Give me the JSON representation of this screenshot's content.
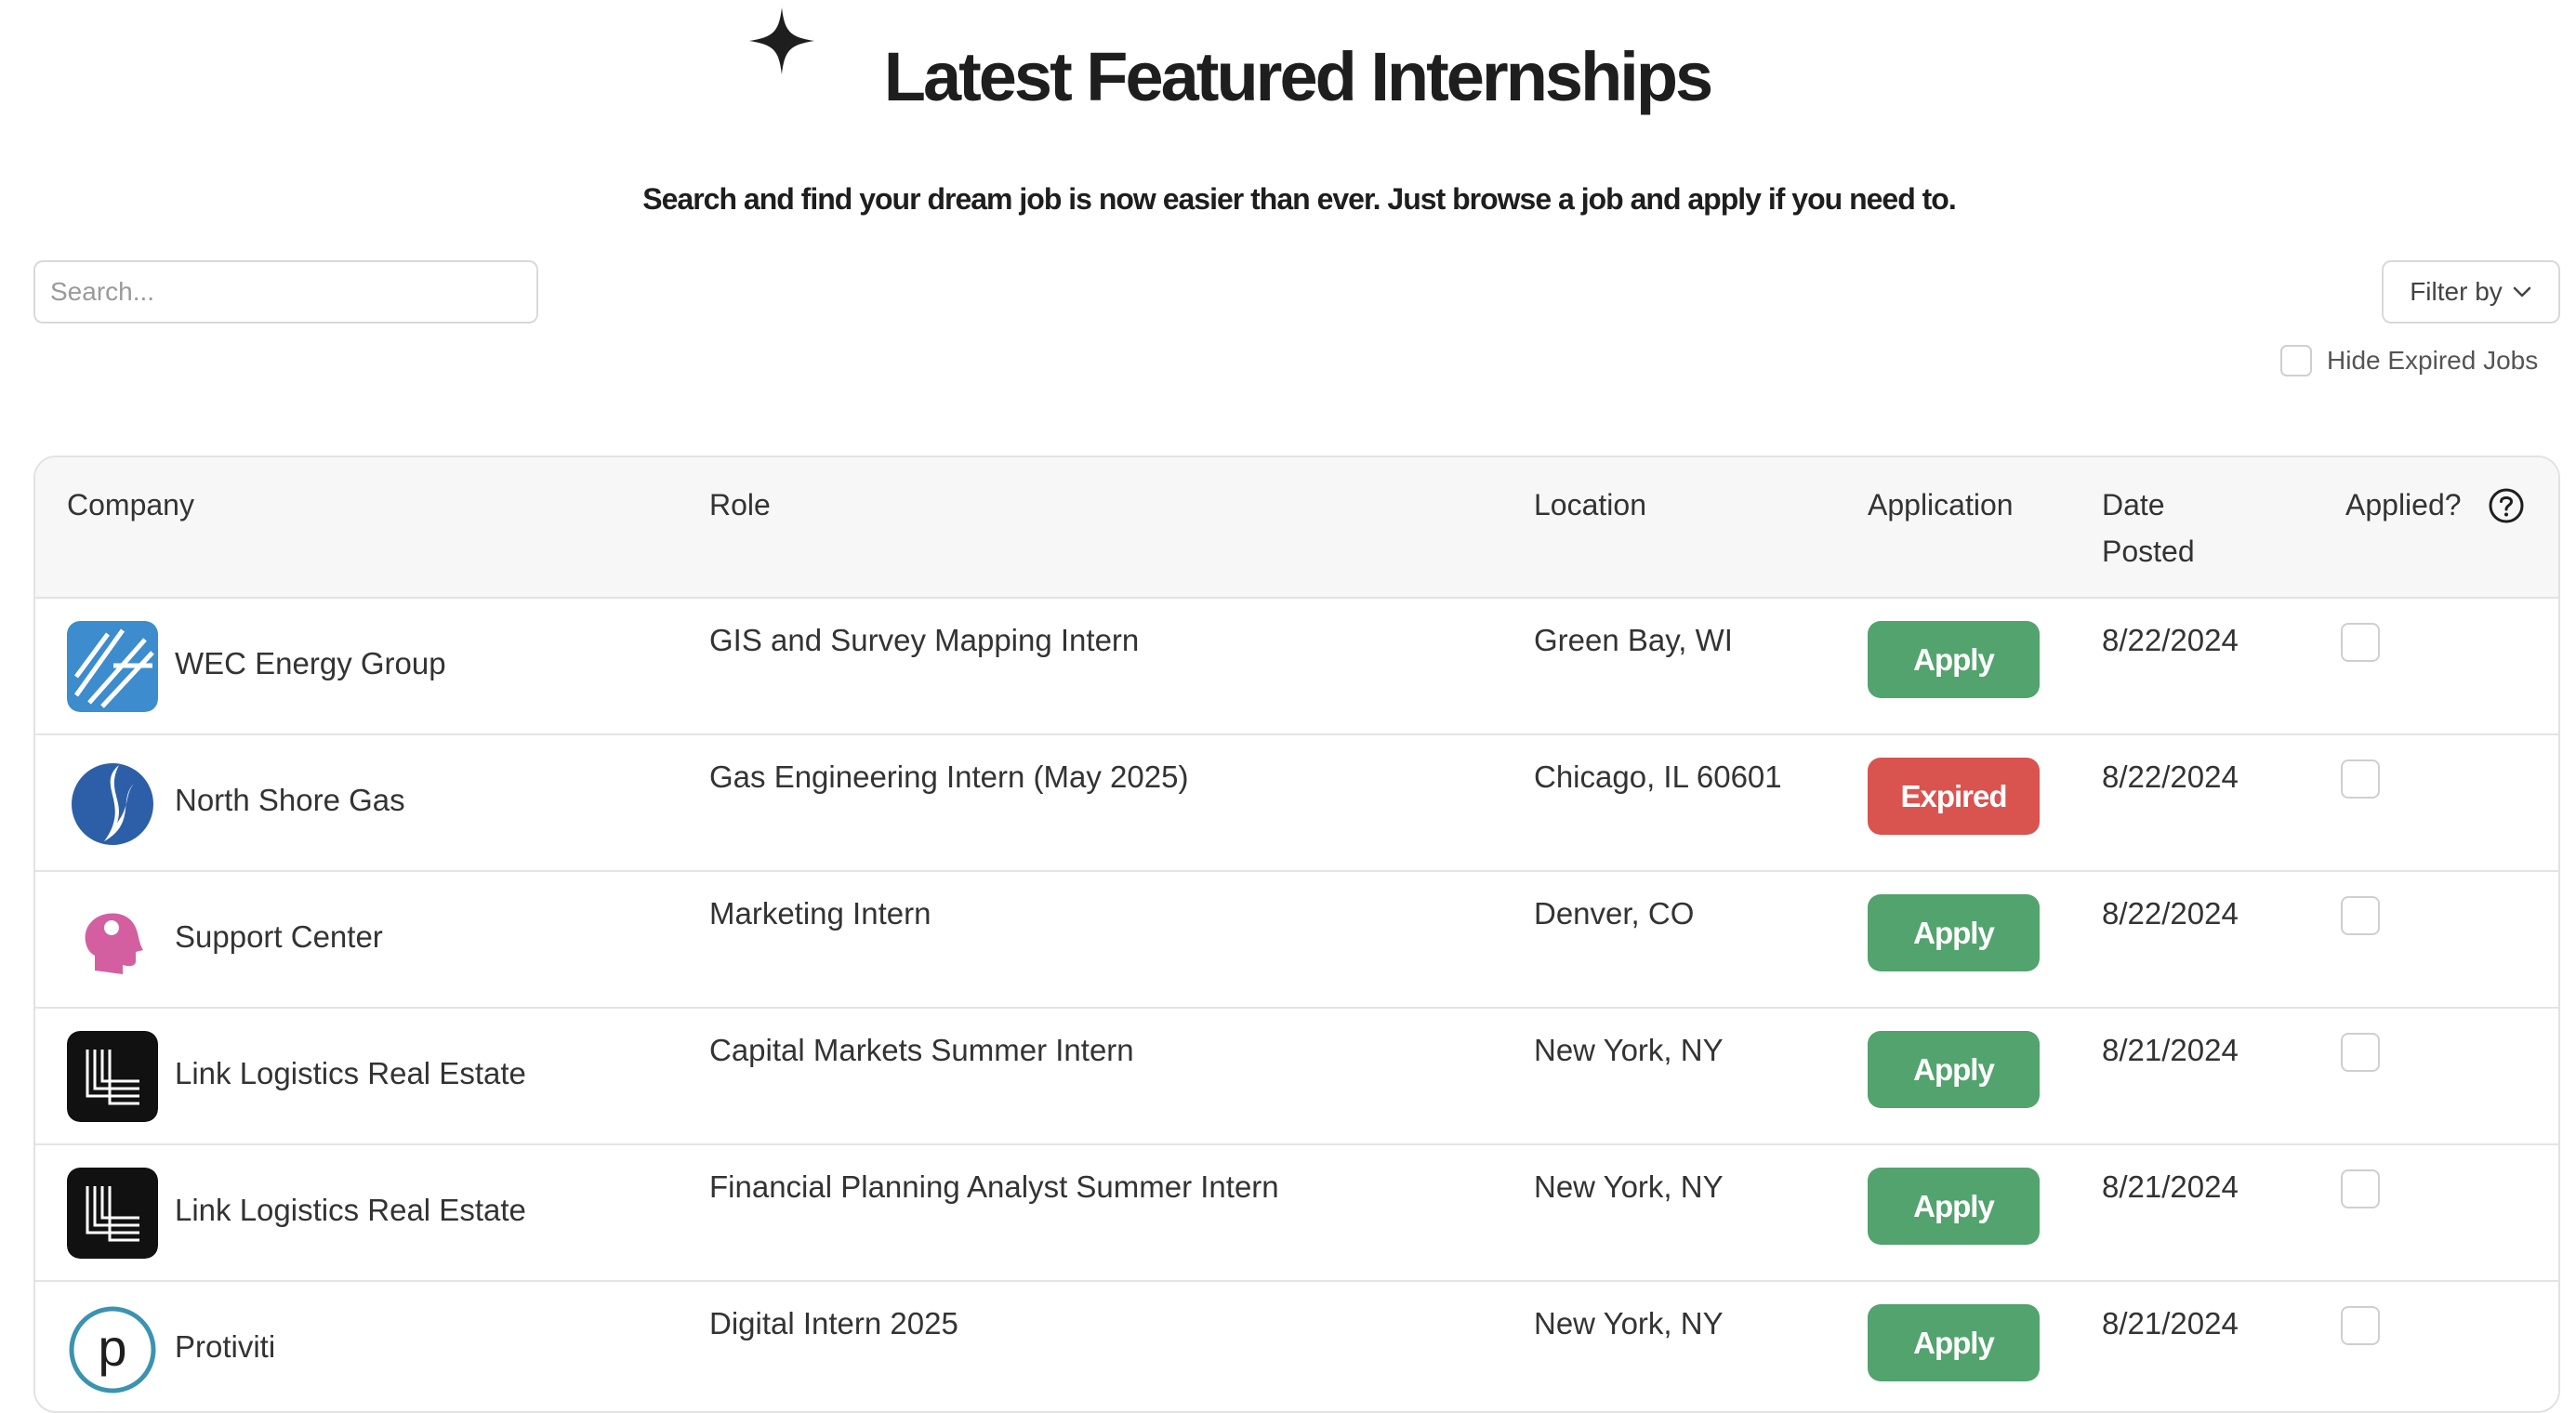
{
  "header": {
    "title": "Latest Featured Internships",
    "subtitle": "Search and find your dream job is now easier than ever. Just browse a job and apply if you need to."
  },
  "search": {
    "placeholder": "Search..."
  },
  "filter": {
    "label": "Filter by"
  },
  "hide_expired": {
    "label": "Hide Expired Jobs",
    "checked": false
  },
  "table": {
    "columns": {
      "company": "Company",
      "role": "Role",
      "location": "Location",
      "application": "Application",
      "date_posted": "Date Posted",
      "applied": "Applied?"
    },
    "rows": [
      {
        "company": "WEC Energy Group",
        "logo": "wec-energy-logo",
        "role": "GIS and Survey Mapping Intern",
        "location": "Green Bay, WI",
        "application": "Apply",
        "status": "apply",
        "date": "8/22/2024",
        "applied": false
      },
      {
        "company": "North Shore Gas",
        "logo": "north-shore-gas-logo",
        "role": "Gas Engineering Intern (May 2025)",
        "location": "Chicago, IL 60601",
        "application": "Expired",
        "status": "expired",
        "date": "8/22/2024",
        "applied": false
      },
      {
        "company": "Support Center",
        "logo": "support-center-logo",
        "role": "Marketing Intern",
        "location": "Denver, CO",
        "application": "Apply",
        "status": "apply",
        "date": "8/22/2024",
        "applied": false
      },
      {
        "company": "Link Logistics Real Estate",
        "logo": "link-logistics-logo",
        "role": "Capital Markets Summer Intern",
        "location": "New York, NY",
        "application": "Apply",
        "status": "apply",
        "date": "8/21/2024",
        "applied": false
      },
      {
        "company": "Link Logistics Real Estate",
        "logo": "link-logistics-logo",
        "role": "Financial Planning Analyst Summer Intern",
        "location": "New York, NY",
        "application": "Apply",
        "status": "apply",
        "date": "8/21/2024",
        "applied": false
      },
      {
        "company": "Protiviti",
        "logo": "protiviti-logo",
        "role": "Digital Intern 2025",
        "location": "New York, NY",
        "application": "Apply",
        "status": "apply",
        "date": "8/21/2024",
        "applied": false
      }
    ]
  },
  "colors": {
    "apply": "#52a36d",
    "expired": "#d9534f",
    "header_bg": "#f7f7f7",
    "border": "#e2e2e2"
  }
}
